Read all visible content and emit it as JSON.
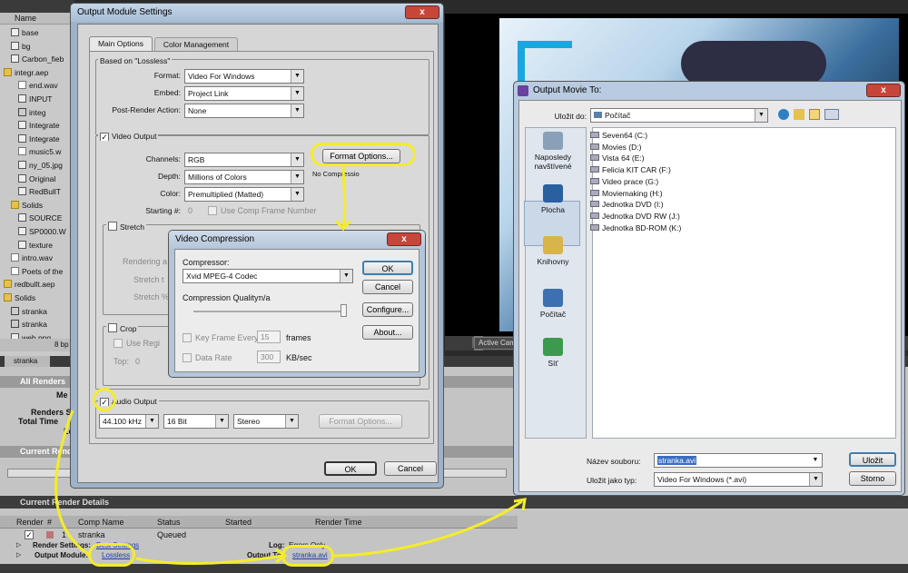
{
  "project": {
    "header": "Name",
    "items": [
      {
        "label": "base",
        "icon": "image-icon",
        "indent": 1
      },
      {
        "label": "bg",
        "icon": "image-icon",
        "indent": 1
      },
      {
        "label": "Carbon_fieb",
        "icon": "image-icon",
        "indent": 1
      },
      {
        "label": "integr.aep",
        "icon": "folder-icon",
        "indent": 0
      },
      {
        "label": "end.wav",
        "icon": "audio-icon",
        "indent": 2
      },
      {
        "label": "INPUT",
        "icon": "image-icon",
        "indent": 2
      },
      {
        "label": "integ",
        "icon": "comp-icon",
        "indent": 2
      },
      {
        "label": "Integrate",
        "icon": "image-icon",
        "indent": 2
      },
      {
        "label": "Integrate",
        "icon": "image-icon",
        "indent": 2
      },
      {
        "label": "music5.w",
        "icon": "audio-icon",
        "indent": 2
      },
      {
        "label": "ny_05.jpg",
        "icon": "image-icon",
        "indent": 2
      },
      {
        "label": "Original",
        "icon": "image-icon",
        "indent": 2
      },
      {
        "label": "RedBullT",
        "icon": "image-icon",
        "indent": 2
      },
      {
        "label": "Solids",
        "icon": "folder-icon",
        "indent": 1
      },
      {
        "label": "SOURCE",
        "icon": "image-icon",
        "indent": 2
      },
      {
        "label": "SP0000.W",
        "icon": "image-icon",
        "indent": 2
      },
      {
        "label": "texture",
        "icon": "image-icon",
        "indent": 2
      },
      {
        "label": "intro.wav",
        "icon": "audio-icon",
        "indent": 1
      },
      {
        "label": "Poets of the",
        "icon": "audio-icon",
        "indent": 1
      },
      {
        "label": "redbullt.aep",
        "icon": "folder-icon",
        "indent": 0
      },
      {
        "label": "Solids",
        "icon": "folder-icon",
        "indent": 0
      },
      {
        "label": "stranka",
        "icon": "comp-icon",
        "indent": 1
      },
      {
        "label": "stranka",
        "icon": "comp-icon",
        "indent": 1
      },
      {
        "label": "web.png",
        "icon": "image-icon",
        "indent": 1
      }
    ],
    "bpc": "8 bp"
  },
  "comp_bar": {
    "active_camera": "Active Cam"
  },
  "render_queue": {
    "tab": "stranka",
    "all_renders": "All Renders",
    "labels": {
      "message": "Me",
      "renders_started": "Renders St",
      "total_time": "Total Time",
      "log": "Lo"
    },
    "current_render": "Current Rende",
    "current_render_details": "Current Render Details",
    "columns": [
      "Render",
      "#",
      "Comp Name",
      "Status",
      "Started",
      "Render Time"
    ],
    "row": {
      "num": "1",
      "comp": "stranka",
      "status": "Queued"
    },
    "render_settings_label": "Render Settings:",
    "render_settings_value": "Best Settings",
    "log_label": "Log:",
    "log_value": "Errors Only",
    "output_module_label": "Output Module:",
    "output_module_value": "Lossless",
    "output_to_label": "Output To:",
    "output_to_value": "stranka.avi"
  },
  "output_module": {
    "title": "Output Module Settings",
    "close": "x",
    "tabs": [
      "Main Options",
      "Color Management"
    ],
    "based_on": "Based on \"Lossless\"",
    "format_label": "Format:",
    "format_value": "Video For Windows",
    "embed_label": "Embed:",
    "embed_value": "Project Link",
    "post_label": "Post-Render Action:",
    "post_value": "None",
    "video_output": "Video Output",
    "channels_label": "Channels:",
    "channels_value": "RGB",
    "depth_label": "Depth:",
    "depth_value": "Millions of Colors",
    "color_label": "Color:",
    "color_value": "Premultiplied (Matted)",
    "starting_label": "Starting #:",
    "starting_value": "0",
    "use_comp_frame": "Use Comp Frame Number",
    "format_options": "Format Options...",
    "no_compression": "No Compressio",
    "stretch": "Stretch",
    "rendering_at": "Rendering a",
    "stretch_to": "Stretch t",
    "stretch_pct": "Stretch %",
    "crop": "Crop",
    "use_region": "Use Regi",
    "top_label": "Top:",
    "top_value": "0",
    "audio_output": "Audio Output",
    "audio_rate": "44.100 kHz",
    "audio_bits": "16 Bit",
    "audio_ch": "Stereo",
    "audio_format_options": "Format Options...",
    "ok": "OK",
    "cancel": "Cancel"
  },
  "video_compression": {
    "title": "Video Compression",
    "close": "x",
    "compressor_label": "Compressor:",
    "compressor_value": "Xvid MPEG-4 Codec",
    "quality_label": "Compression Quality:",
    "quality_value": "n/a",
    "key_frame": "Key Frame Every",
    "key_frame_value": "15",
    "frames": "frames",
    "data_rate": "Data Rate",
    "data_rate_value": "300",
    "kbsec": "KB/sec",
    "ok": "OK",
    "cancel": "Cancel",
    "configure": "Configure...",
    "about": "About..."
  },
  "save_dialog": {
    "title": "Output Movie To:",
    "close": "x",
    "look_in_label": "Uložit do:",
    "look_in_value": "Počítač",
    "places": [
      "Naposledy navštívené",
      "Plocha",
      "Knihovny",
      "Počítač",
      "Síť"
    ],
    "drives": [
      "Seven64 (C:)",
      "Movies (D:)",
      "Vista 64 (E:)",
      "Felicia KIT CAR (F:)",
      "Video prace (G:)",
      "Moviemaking (H:)",
      "Jednotka DVD (I:)",
      "Jednotka DVD RW (J:)",
      "Jednotka BD-ROM (K:)"
    ],
    "filename_label": "Název souboru:",
    "filename_value": "stranka.avi",
    "filetype_label": "Uložit jako typ:",
    "filetype_value": "Video For Windows (*.avi)",
    "save": "Uložit",
    "cancel": "Storno"
  }
}
